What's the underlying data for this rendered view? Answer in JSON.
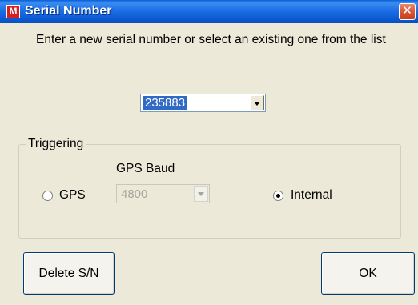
{
  "window": {
    "title": "Serial Number",
    "icon_letter": "M",
    "close_symbol": "✕"
  },
  "prompt": "Enter a new serial number or select an existing one from the list",
  "serial": {
    "selected": "235883"
  },
  "triggering": {
    "label": "Triggering",
    "gps_baud_label": "GPS Baud",
    "gps_radio": {
      "label": "GPS",
      "checked": false
    },
    "baud": {
      "value": "4800",
      "enabled": false
    },
    "internal_radio": {
      "label": "Internal",
      "checked": true
    }
  },
  "buttons": {
    "delete": "Delete S/N",
    "ok": "OK"
  },
  "colors": {
    "title_bar": "#0b57cf",
    "selection": "#316ac5",
    "dialog_bg": "#ece9d8"
  }
}
